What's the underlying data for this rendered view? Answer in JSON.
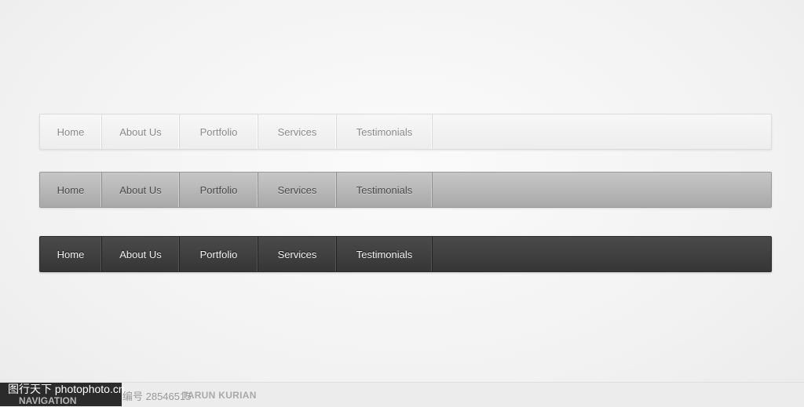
{
  "nav_items": [
    "Home",
    "About Us",
    "Portfolio",
    "Services",
    "Testimonials"
  ],
  "themes": {
    "light": "#f2f2f2",
    "mid": "#b8b8b8",
    "dark": "#404040"
  },
  "footer": {
    "title_fragment": "NAVIGATION",
    "author": "TARUN KURIAN"
  },
  "watermark": {
    "site": "图行天下 photophoto.cn",
    "id": "编号 28546515"
  }
}
